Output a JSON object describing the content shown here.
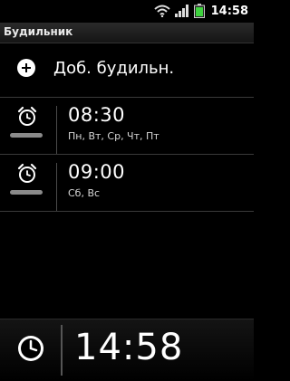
{
  "status_bar": {
    "time": "14:58",
    "icons": [
      "wifi-icon",
      "signal-icon",
      "battery-icon"
    ],
    "battery_color": "#3fd33f"
  },
  "title_bar": {
    "title": "Будильник"
  },
  "add_alarm": {
    "label": "Доб. будильн.",
    "icon": "plus-circle-icon"
  },
  "alarms": [
    {
      "time": "08:30",
      "days": "Пн, Вт, Ср, Чт, Пт",
      "icon": "alarm-clock-icon"
    },
    {
      "time": "09:00",
      "days": "Сб, Вс",
      "icon": "alarm-clock-icon"
    }
  ],
  "bottom_bar": {
    "time": "14:58",
    "icon": "clock-icon"
  }
}
